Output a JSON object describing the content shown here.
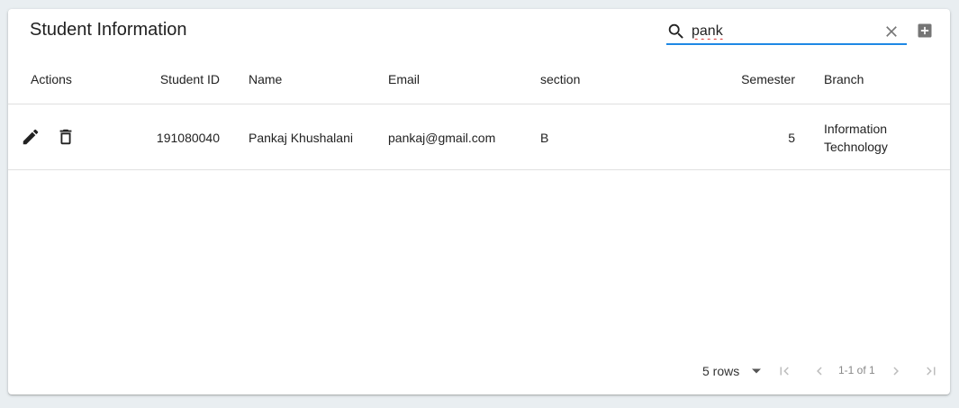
{
  "header": {
    "title": "Student Information",
    "search_value": "pank"
  },
  "table": {
    "columns": {
      "actions": "Actions",
      "student_id": "Student ID",
      "name": "Name",
      "email": "Email",
      "section": "section",
      "semester": "Semester",
      "branch": "Branch"
    },
    "rows": [
      {
        "student_id": "191080040",
        "name": "Pankaj Khushalani",
        "email": "pankaj@gmail.com",
        "section": "B",
        "semester": "5",
        "branch_line1": "Information",
        "branch_line2": "Technology"
      }
    ]
  },
  "pagination": {
    "rows_label": "5 rows",
    "range": "1-1 of 1"
  },
  "icons": {
    "search": "search-icon",
    "clear": "close-icon",
    "add": "add-box-icon",
    "edit": "pencil-icon",
    "delete": "trash-icon",
    "first": "first-page-icon",
    "prev": "chevron-left-icon",
    "next": "chevron-right-icon",
    "last": "last-page-icon"
  },
  "colors": {
    "accent": "#1e88e5",
    "spellcheck": "#d33"
  }
}
